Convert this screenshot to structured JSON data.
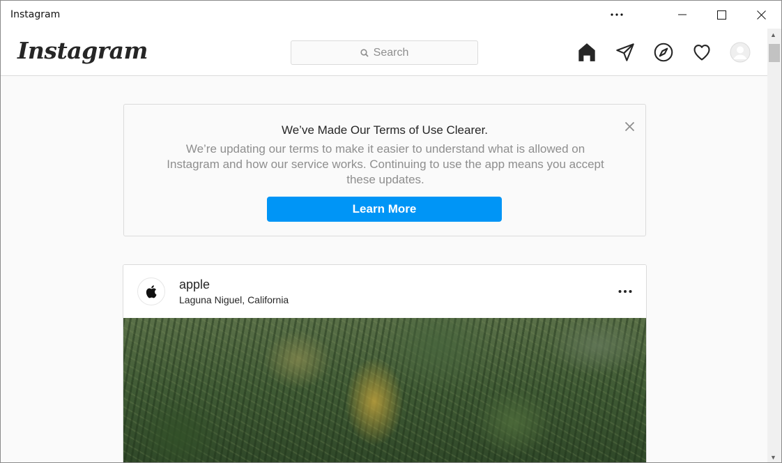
{
  "window": {
    "title": "Instagram",
    "controls": {
      "more": "more-options",
      "minimize": "minimize",
      "maximize": "maximize",
      "close": "close"
    }
  },
  "header": {
    "logo_text": "Instagram",
    "search": {
      "placeholder": "Search"
    },
    "nav_icons": [
      "home-icon",
      "direct-message-icon",
      "explore-compass-icon",
      "activity-heart-icon",
      "profile-avatar-icon"
    ]
  },
  "terms_notice": {
    "title": "We’ve Made Our Terms of Use Clearer.",
    "body": "We’re updating our terms to make it easier to understand what is allowed on Instagram and how our service works. Continuing to use the app means you accept these updates.",
    "button_label": "Learn More",
    "button_color": "#0095f6"
  },
  "post": {
    "username": "apple",
    "location": "Laguna Niguel, California",
    "avatar_icon": "apple-logo-icon",
    "more_icon": "more-horizontal-icon"
  },
  "colors": {
    "background": "#fafafa",
    "border": "#dbdbdb",
    "accent": "#0095f6",
    "secondary_text": "#8e8e8e"
  }
}
